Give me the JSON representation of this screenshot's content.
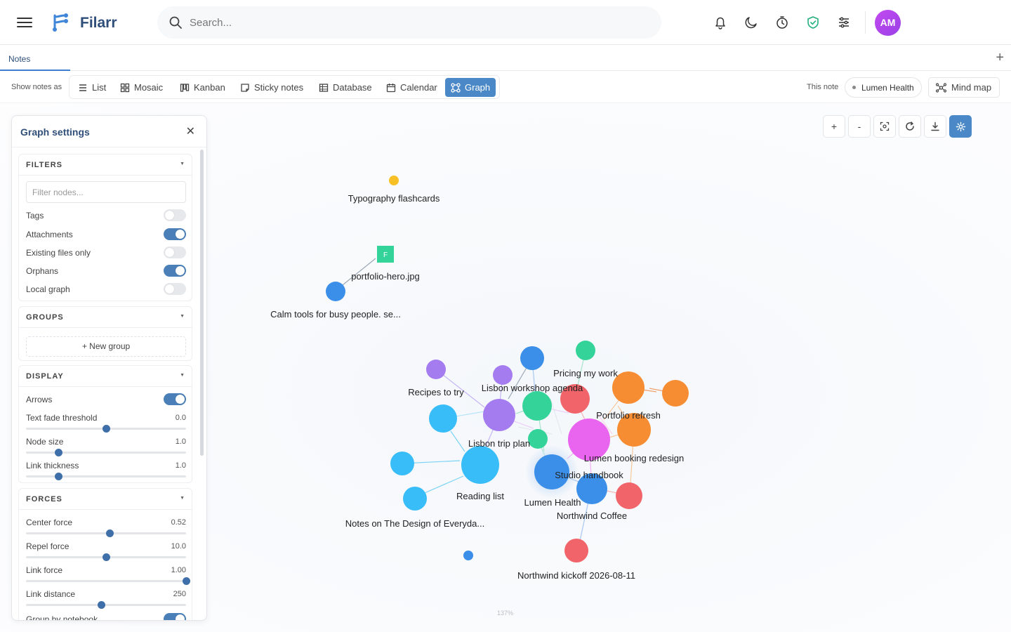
{
  "app": {
    "brand": "Filarr",
    "avatar_initials": "AM",
    "accent": "#4a88c7",
    "avatar_color": "#b045ec"
  },
  "search": {
    "placeholder": "Search..."
  },
  "topbar_icons": [
    "bell-icon",
    "moon-icon",
    "timer-icon",
    "shield-check-icon",
    "sliders-icon"
  ],
  "tabs": [
    {
      "label": "Notes",
      "active": true
    }
  ],
  "viewbar": {
    "show_label": "Show notes as",
    "views": [
      {
        "id": "list",
        "label": "List",
        "icon": "list-icon",
        "active": false
      },
      {
        "id": "mosaic",
        "label": "Mosaic",
        "icon": "mosaic-icon",
        "active": false
      },
      {
        "id": "kanban",
        "label": "Kanban",
        "icon": "kanban-icon",
        "active": false
      },
      {
        "id": "sticky",
        "label": "Sticky notes",
        "icon": "sticky-note-icon",
        "active": false
      },
      {
        "id": "database",
        "label": "Database",
        "icon": "database-icon",
        "active": false
      },
      {
        "id": "calendar",
        "label": "Calendar",
        "icon": "calendar-icon",
        "active": false
      },
      {
        "id": "graph",
        "label": "Graph",
        "icon": "graph-icon",
        "active": true
      }
    ],
    "this_note_label": "This note",
    "this_note_value": "Lumen Health",
    "mindmap_label": "Mind map"
  },
  "graph_controls": [
    {
      "id": "zoom-in",
      "label": "+"
    },
    {
      "id": "zoom-out",
      "label": "-"
    },
    {
      "id": "fit",
      "label": ""
    },
    {
      "id": "reset",
      "label": ""
    },
    {
      "id": "download",
      "label": ""
    },
    {
      "id": "settings",
      "label": ""
    }
  ],
  "graph": {
    "zoom_label": "137%",
    "nodes": [
      {
        "id": "typo",
        "label": "Typography flashcards",
        "color": "#f6c026",
        "size": "small"
      },
      {
        "id": "portfolio_img",
        "label": "portfolio-hero.jpg",
        "color": "#34d399",
        "kind": "file",
        "badge": "F"
      },
      {
        "id": "calm",
        "label": "Calm tools for busy people. se...",
        "color": "#3b8fe8",
        "size": "medium"
      },
      {
        "id": "recipes",
        "label": "Recipes to try",
        "color": "#a57cf0",
        "size": "medium"
      },
      {
        "id": "lisbon_ws",
        "label": "Lisbon workshop agenda",
        "color": "#a57cf0",
        "size": "medium"
      },
      {
        "id": "pricing",
        "label": "Pricing my work",
        "color": "#34d399",
        "size": "medium"
      },
      {
        "id": "portfolio_refresh",
        "label": "Portfolio refresh",
        "color": "#f68d33",
        "size": "large"
      },
      {
        "id": "lisbon_trip",
        "label": "Lisbon trip plan",
        "color": "#a57cf0",
        "size": "large"
      },
      {
        "id": "lumen_booking",
        "label": "Lumen booking redesign",
        "color": "#e964ef",
        "size": "large"
      },
      {
        "id": "studio",
        "label": "Studio handbook",
        "color": "#3b8fe8",
        "size": "large"
      },
      {
        "id": "lumen_health",
        "label": "Lumen Health",
        "color": "#3b8fe8",
        "size": "large"
      },
      {
        "id": "reading",
        "label": "Reading list",
        "color": "#38bdf8",
        "size": "large"
      },
      {
        "id": "northwind",
        "label": "Northwind Coffee",
        "color": "#f0646a",
        "size": "medium"
      },
      {
        "id": "design_notes",
        "label": "Notes on The Design of Everyda...",
        "color": "#38bdf8",
        "size": "medium"
      },
      {
        "id": "kickoff",
        "label": "Northwind kickoff 2026-08-11",
        "color": "#f0646a",
        "size": "medium"
      }
    ]
  },
  "settings": {
    "title": "Graph settings",
    "filters": {
      "title": "FILTERS",
      "placeholder": "Filter nodes...",
      "toggles": [
        {
          "label": "Tags",
          "on": false
        },
        {
          "label": "Attachments",
          "on": true
        },
        {
          "label": "Existing files only",
          "on": false
        },
        {
          "label": "Orphans",
          "on": true
        },
        {
          "label": "Local graph",
          "on": false
        }
      ]
    },
    "groups": {
      "title": "GROUPS",
      "new_group": "+ New group"
    },
    "display": {
      "title": "DISPLAY",
      "arrows": {
        "label": "Arrows",
        "on": true
      },
      "sliders": [
        {
          "label": "Text fade threshold",
          "value": "0.0",
          "fraction": 0.5
        },
        {
          "label": "Node size",
          "value": "1.0",
          "fraction": 0.2
        },
        {
          "label": "Link thickness",
          "value": "1.0",
          "fraction": 0.2
        }
      ]
    },
    "forces": {
      "title": "FORCES",
      "sliders": [
        {
          "label": "Center force",
          "value": "0.52",
          "fraction": 0.52
        },
        {
          "label": "Repel force",
          "value": "10.0",
          "fraction": 0.5
        },
        {
          "label": "Link force",
          "value": "1.00",
          "fraction": 1.0
        },
        {
          "label": "Link distance",
          "value": "250",
          "fraction": 0.47
        }
      ],
      "group_by_notebook": {
        "label": "Group by notebook",
        "on": true
      }
    }
  }
}
